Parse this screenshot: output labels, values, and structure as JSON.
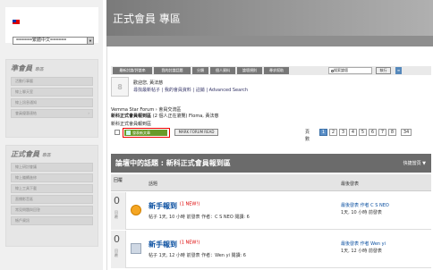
{
  "language": {
    "selected": "======繁體中文======",
    "arrow": "▼"
  },
  "left_sections": [
    {
      "title": "準會員",
      "subtitle": "專區",
      "items": [
        "活動行事曆",
        "線上聊天室",
        "線上訊息通知",
        "會員優惠連結"
      ]
    },
    {
      "title": "正式會員",
      "subtitle": "專區",
      "items": [
        "線上研討會議",
        "線上繼續進修",
        "線上工具下載",
        "直播影音區",
        "常見問題與回答",
        "帳戶資訊"
      ]
    }
  ],
  "header": {
    "title": "正式會員 專區"
  },
  "navbar": {
    "buttons": [
      "最新討論/評論串",
      "我的討論話題",
      "分類",
      "個人資料",
      "論壇規則",
      "尋求幫助"
    ],
    "search_placeholder": "搜索論壇",
    "search_button": "執行",
    "icon_glyph": "≡"
  },
  "welcome": {
    "logo_text": "8",
    "line1": "歡迎您, 黃法慈",
    "line2": "尋找最新帖子 | 我的會員資料 | 註銷 | Advanced Search"
  },
  "breadcrumb": {
    "line1": "Vemma Star Forum › 會員交流區",
    "line2_main": "新科正式會員報到區",
    "line2_sub": "(2 個人正在瀏覽) Floma, 黃法慈",
    "forum_name": "新科正式會員報到區"
  },
  "actions": {
    "post_button": "發表新文章",
    "mark_read": "MARK FORUM READ"
  },
  "pager": {
    "label": "頁數",
    "pages": [
      "1",
      "2",
      "3",
      "4",
      "5",
      "6",
      "7",
      "8",
      "34"
    ],
    "active": "1"
  },
  "forum_bar": {
    "title": "論壇中的話題 : 新科正式會員報到區",
    "quick": "快捷當頁 ▼"
  },
  "table": {
    "col_count": "回覆",
    "col_topic": "話題",
    "col_last": "最後發表"
  },
  "topics": [
    {
      "count": "0",
      "count_sub": "回覆",
      "title": "新手報到",
      "new": "(1 NEW!)",
      "meta": "帖子 1天, 10 小時 前發表 作者：C S NEO 閱讀: 6",
      "last_line1": "最後發表 作者 C S NEO",
      "last_line2": "1天, 10 小時 前發表"
    },
    {
      "count": "0",
      "count_sub": "回覆",
      "title": "新手報到",
      "new": "(1 NEW!)",
      "meta": "帖子 1天, 12 小時 前發表 作者：Wen yi 閱讀: 6",
      "last_line1": "最後發表 作者 Wen yi",
      "last_line2": "1天, 12 小時 前發表"
    }
  ]
}
